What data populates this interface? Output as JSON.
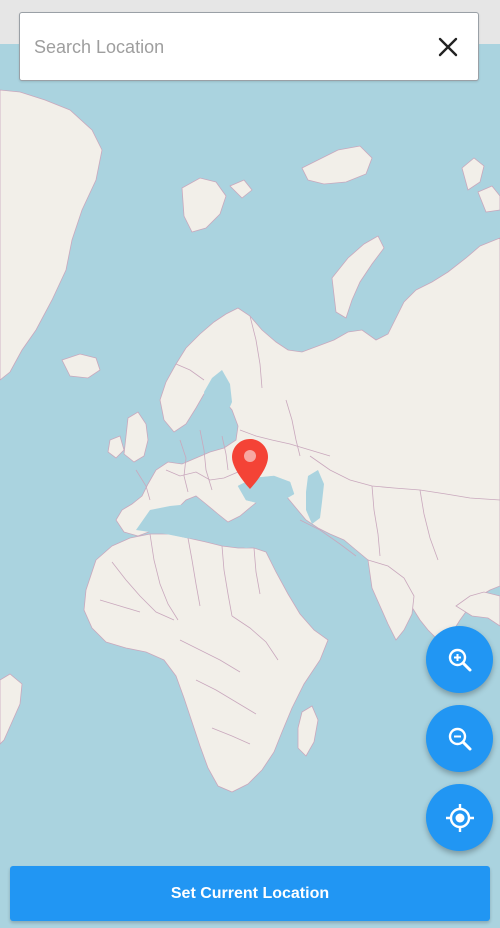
{
  "search": {
    "placeholder": "Search Location",
    "value": ""
  },
  "icons": {
    "clear": "close-icon",
    "zoom_in": "zoom-in-icon",
    "zoom_out": "zoom-out-icon",
    "locate": "my-location-icon",
    "marker": "location-pin-icon"
  },
  "actions": {
    "set_current_location_label": "Set Current Location"
  },
  "colors": {
    "accent": "#2196f3",
    "marker": "#f44336",
    "water": "#aad3df",
    "land": "#f2efe9",
    "border": "#c9a8bd"
  }
}
